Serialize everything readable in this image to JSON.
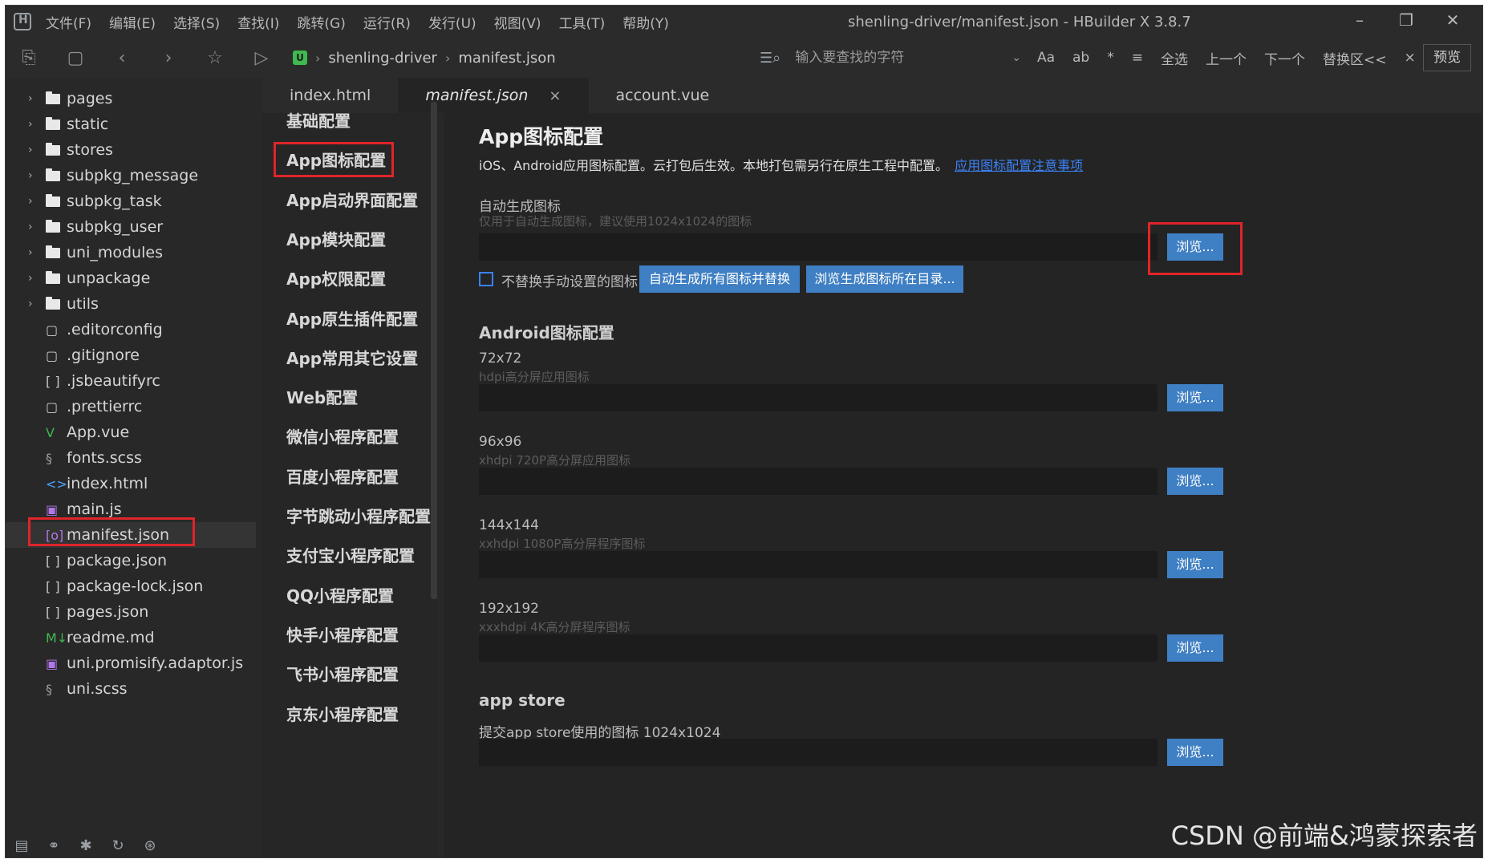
{
  "window": {
    "title": "shenling-driver/manifest.json - HBuilder X 3.8.7",
    "menu": [
      "文件(F)",
      "编辑(E)",
      "选择(S)",
      "查找(I)",
      "跳转(G)",
      "运行(R)",
      "发行(U)",
      "视图(V)",
      "工具(T)",
      "帮助(Y)"
    ]
  },
  "toolbar": {
    "breadcrumb": [
      "shenling-driver",
      "manifest.json"
    ],
    "find_placeholder": "输入要查找的字符",
    "find_options": [
      "Aa",
      "ab",
      "*",
      "≡",
      "全选",
      "上一个",
      "下一个",
      "替换区<<",
      "×"
    ],
    "preview_label": "预览"
  },
  "explorer": {
    "folders": [
      "pages",
      "static",
      "stores",
      "subpkg_message",
      "subpkg_task",
      "subpkg_user",
      "uni_modules",
      "unpackage",
      "utils"
    ],
    "files": [
      {
        "name": ".editorconfig",
        "icon": "file-icon"
      },
      {
        "name": ".gitignore",
        "icon": "file-icon"
      },
      {
        "name": ".jsbeautifyrc",
        "icon": "json-icon"
      },
      {
        "name": ".prettierrc",
        "icon": "file-icon"
      },
      {
        "name": "App.vue",
        "icon": "vue-icon"
      },
      {
        "name": "fonts.scss",
        "icon": "scss-icon"
      },
      {
        "name": "index.html",
        "icon": "html-icon"
      },
      {
        "name": "main.js",
        "icon": "js-icon"
      },
      {
        "name": "manifest.json",
        "icon": "manifest-icon"
      },
      {
        "name": "package.json",
        "icon": "json-icon"
      },
      {
        "name": "package-lock.json",
        "icon": "json-icon"
      },
      {
        "name": "pages.json",
        "icon": "json-icon"
      },
      {
        "name": "readme.md",
        "icon": "markdown-icon"
      },
      {
        "name": "uni.promisify.adaptor.js",
        "icon": "js-icon"
      },
      {
        "name": "uni.scss",
        "icon": "scss-icon"
      }
    ],
    "active_file": "manifest.json"
  },
  "tabs": [
    {
      "label": "index.html"
    },
    {
      "label": "manifest.json",
      "close": "×"
    },
    {
      "label": "account.vue"
    }
  ],
  "settings_nav": [
    "基础配置",
    "App图标配置",
    "App启动界面配置",
    "App模块配置",
    "App权限配置",
    "App原生插件配置",
    "App常用其它设置",
    "Web配置",
    "微信小程序配置",
    "百度小程序配置",
    "字节跳动小程序配置",
    "支付宝小程序配置",
    "QQ小程序配置",
    "快手小程序配置",
    "飞书小程序配置",
    "京东小程序配置"
  ],
  "main": {
    "title": "App图标配置",
    "description": "iOS、Android应用图标配置。云打包后生效。本地打包需另行在原生工程中配置。",
    "link": "应用图标配置注意事项",
    "auto_label": "自动生成图标",
    "auto_hint": "仅用于自动生成图标，建议使用1024x1024的图标",
    "browse_label": "浏览...",
    "no_replace_label": "不替换手动设置的图标",
    "auto_replace_btn": "自动生成所有图标并替换",
    "browse_dir_btn": "浏览生成图标所在目录...",
    "android_section": "Android图标配置",
    "android_icons": [
      {
        "size": "72x72",
        "hint": "hdpi高分屏应用图标"
      },
      {
        "size": "96x96",
        "hint": "xhdpi 720P高分屏应用图标"
      },
      {
        "size": "144x144",
        "hint": "xxhdpi 1080P高分屏程序图标"
      },
      {
        "size": "192x192",
        "hint": "xxxhdpi 4K高分屏程序图标"
      }
    ],
    "appstore_section": "app store",
    "appstore_label": "提交app store使用的图标 1024x1024"
  },
  "watermark": "CSDN @前端&鸿蒙探索者",
  "colors": {
    "accent": "#3f7fc3",
    "highlight_border": "#e0242a",
    "link": "#3b82f6"
  }
}
